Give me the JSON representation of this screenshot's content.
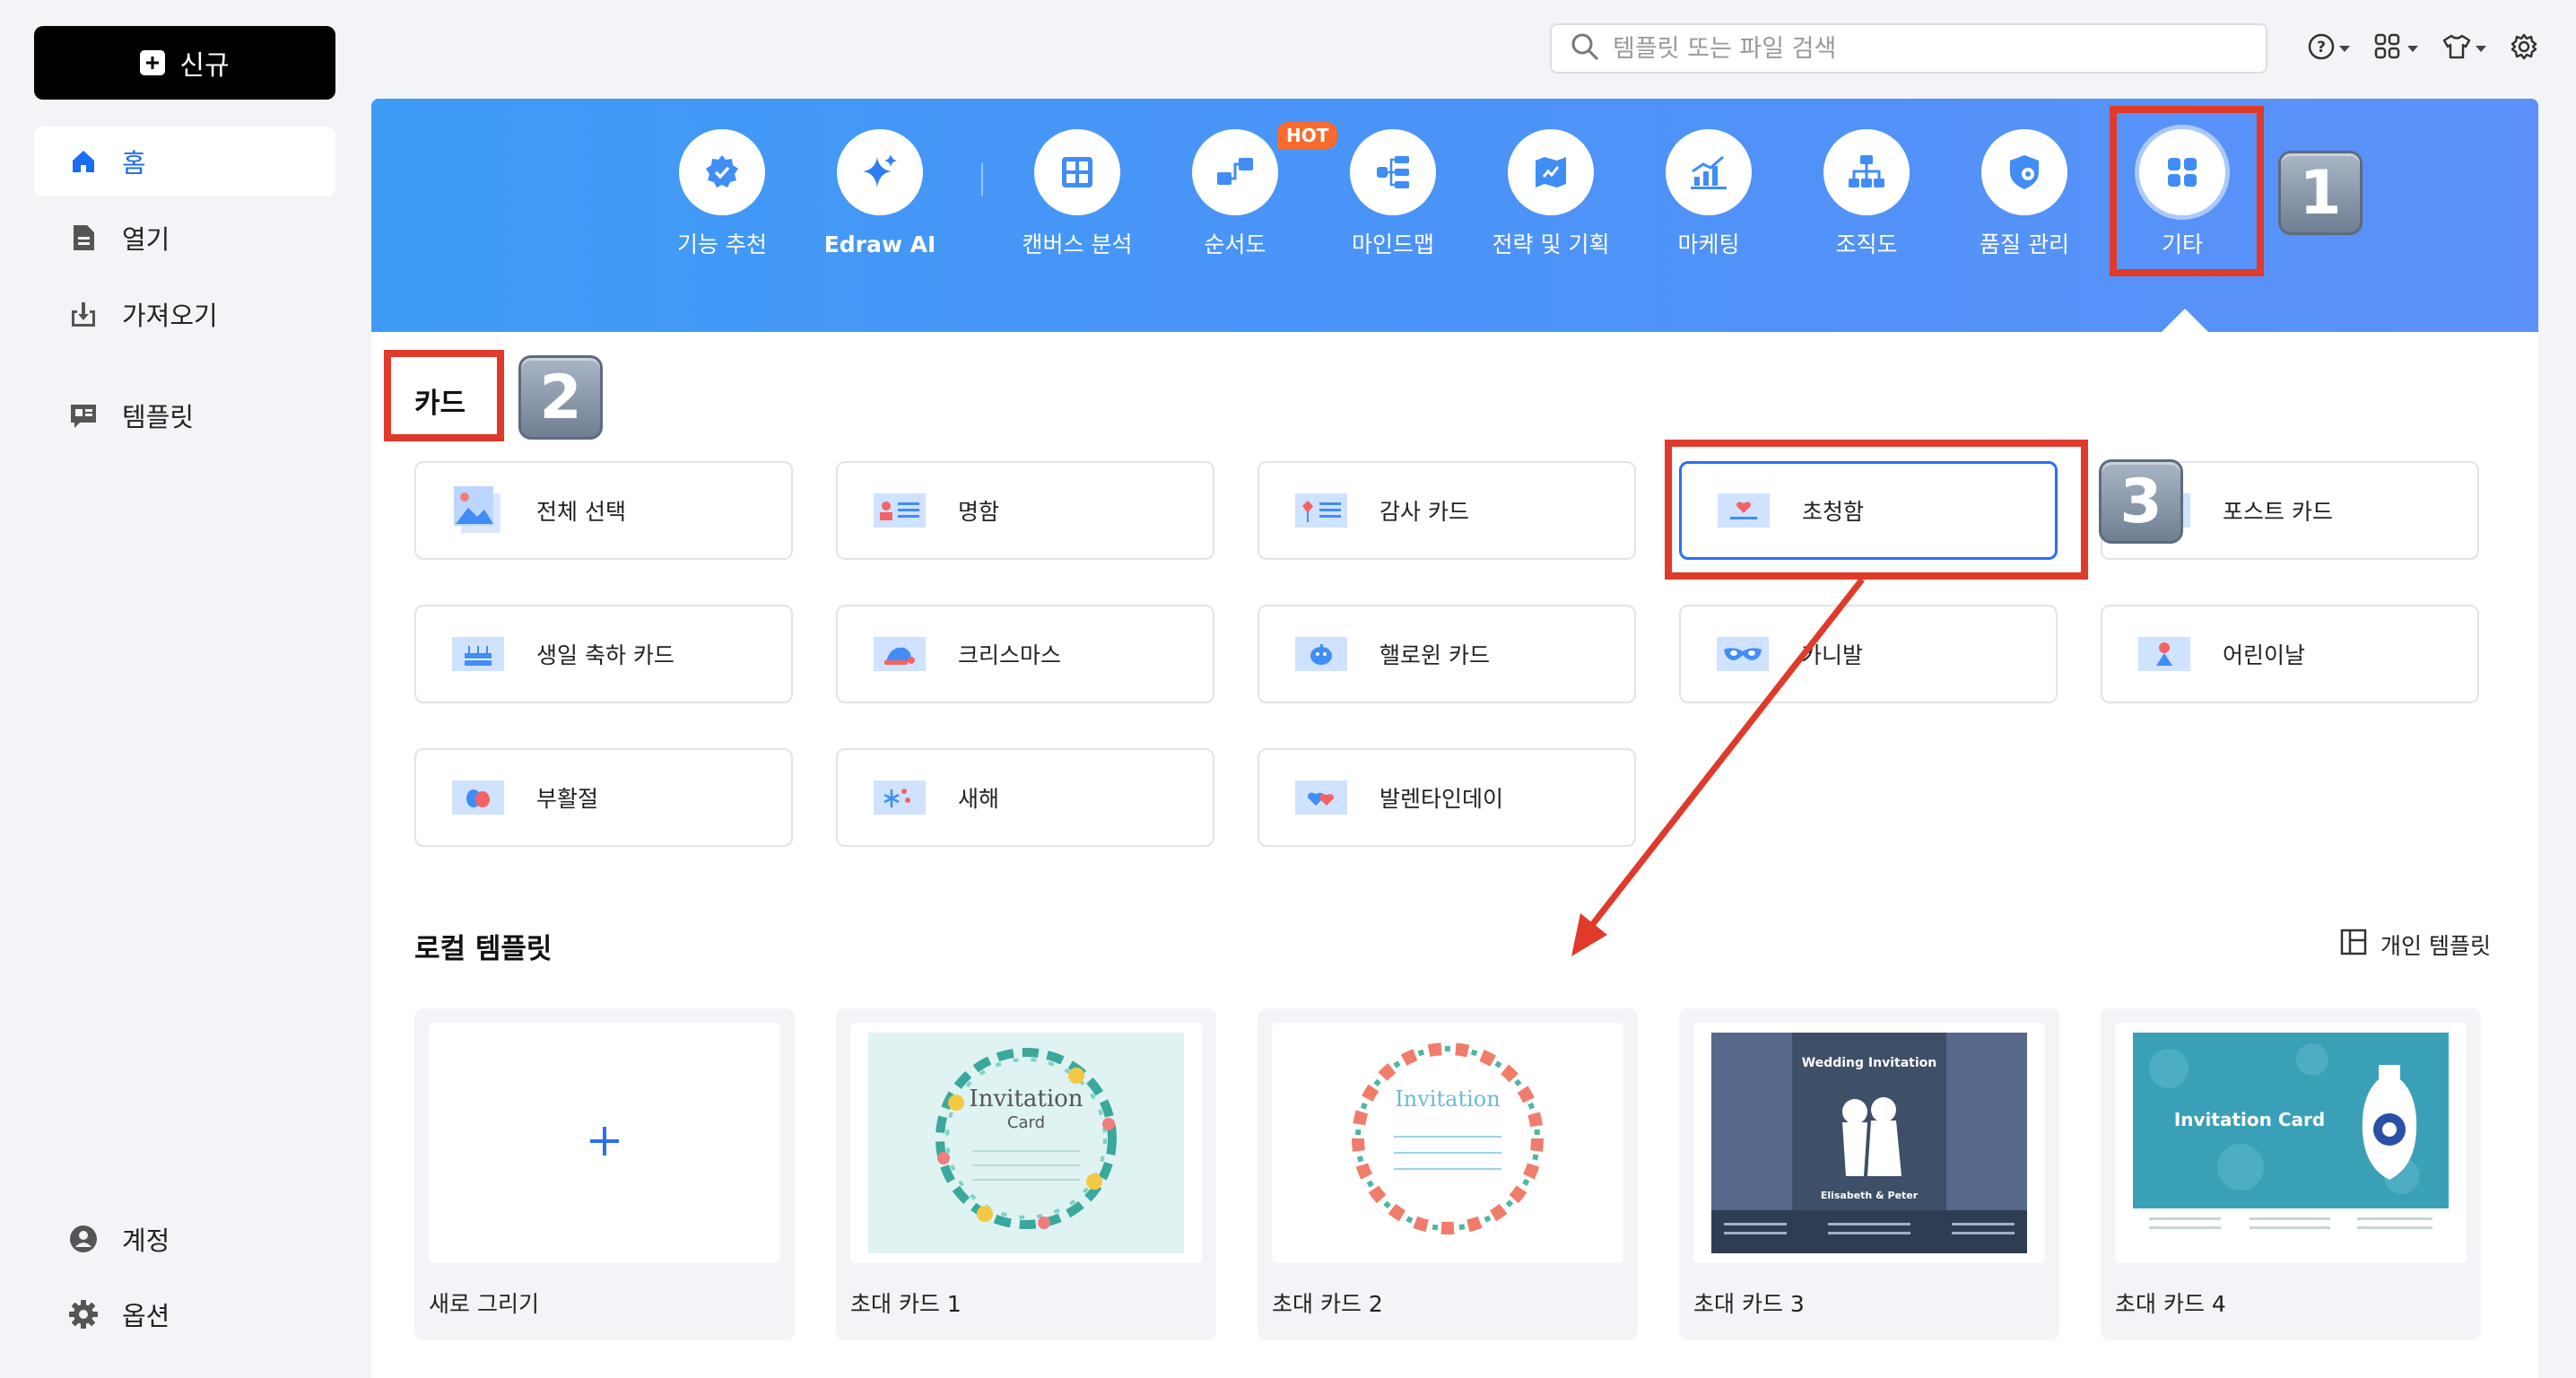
{
  "sidebar": {
    "new_label": "신규",
    "items": [
      {
        "label": "홈",
        "icon": "home-icon"
      },
      {
        "label": "열기",
        "icon": "document-icon"
      },
      {
        "label": "가져오기",
        "icon": "import-icon"
      },
      {
        "label": "템플릿",
        "icon": "template-icon"
      }
    ],
    "bottom": [
      {
        "label": "계정",
        "icon": "account-icon"
      },
      {
        "label": "옵션",
        "icon": "gear-icon"
      }
    ]
  },
  "search": {
    "placeholder": "템플릿 또는 파일 검색"
  },
  "banner": {
    "hot_badge": "HOT",
    "categories": [
      {
        "label": "기능 추천",
        "icon": "recommend-icon"
      },
      {
        "label": "Edraw AI",
        "icon": "sparkle-icon"
      },
      {
        "label": "캔버스 분석",
        "icon": "canvas-icon"
      },
      {
        "label": "순서도",
        "icon": "flowchart-icon"
      },
      {
        "label": "마인드맵",
        "icon": "mindmap-icon"
      },
      {
        "label": "전략 및 기획",
        "icon": "strategy-icon"
      },
      {
        "label": "마케팅",
        "icon": "marketing-icon"
      },
      {
        "label": "조직도",
        "icon": "org-chart-icon"
      },
      {
        "label": "품질 관리",
        "icon": "quality-icon"
      },
      {
        "label": "기타",
        "icon": "grid-icon"
      }
    ]
  },
  "card_section": {
    "title": "카드",
    "items": [
      "전체 선택",
      "명함",
      "감사 카드",
      "초청함",
      "포스트 카드",
      "생일 축하 카드",
      "크리스마스",
      "핼로윈 카드",
      "카니발",
      "어린이날",
      "부활절",
      "새해",
      "발렌타인데이"
    ]
  },
  "local_templates": {
    "title": "로컬 템플릿",
    "personal_label": "개인 템플릿",
    "items": [
      {
        "label": "새로 그리기"
      },
      {
        "label": "초대 카드 1",
        "thumb_text": [
          "Invitation",
          "Card"
        ]
      },
      {
        "label": "초대 카드 2",
        "thumb_text": [
          "Invitation"
        ]
      },
      {
        "label": "초대 카드 3",
        "thumb_text": [
          "Wedding Invitation",
          "Elisabeth & Peter"
        ]
      },
      {
        "label": "초대 카드 4",
        "thumb_text": [
          "Invitation Card"
        ]
      }
    ]
  },
  "annotations": {
    "badges": [
      "1",
      "2",
      "3"
    ]
  },
  "colors": {
    "accent": "#1a6df0",
    "banner": "#4b93f8",
    "annotation_red": "#e03a2a"
  }
}
